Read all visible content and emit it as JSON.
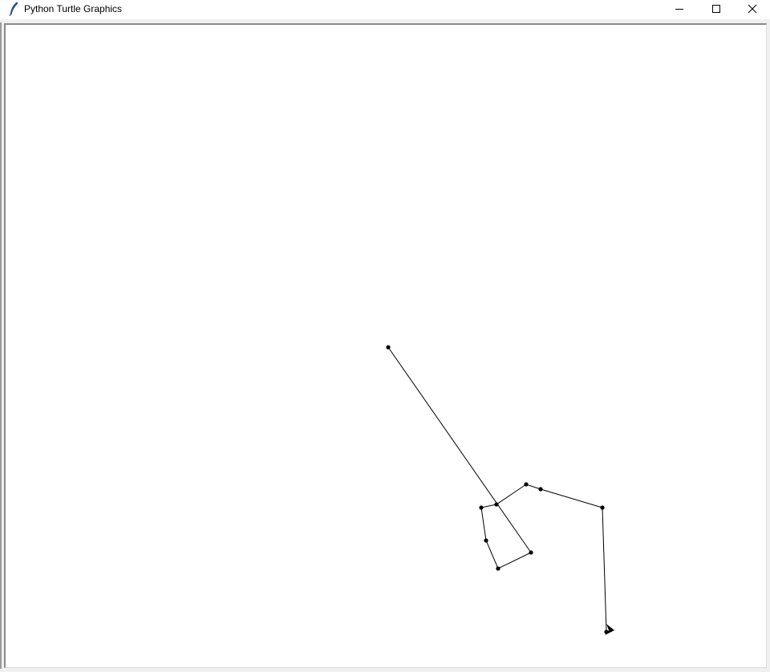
{
  "window": {
    "title": "Python Turtle Graphics",
    "icon": "feather-icon",
    "controls": [
      "minimize-icon",
      "maximize-icon",
      "close-icon"
    ]
  },
  "canvas": {
    "background": "#ffffff",
    "pen_color": "#000000",
    "turtle_icon": "turtle-arrow-icon",
    "dot_count": 11
  }
}
